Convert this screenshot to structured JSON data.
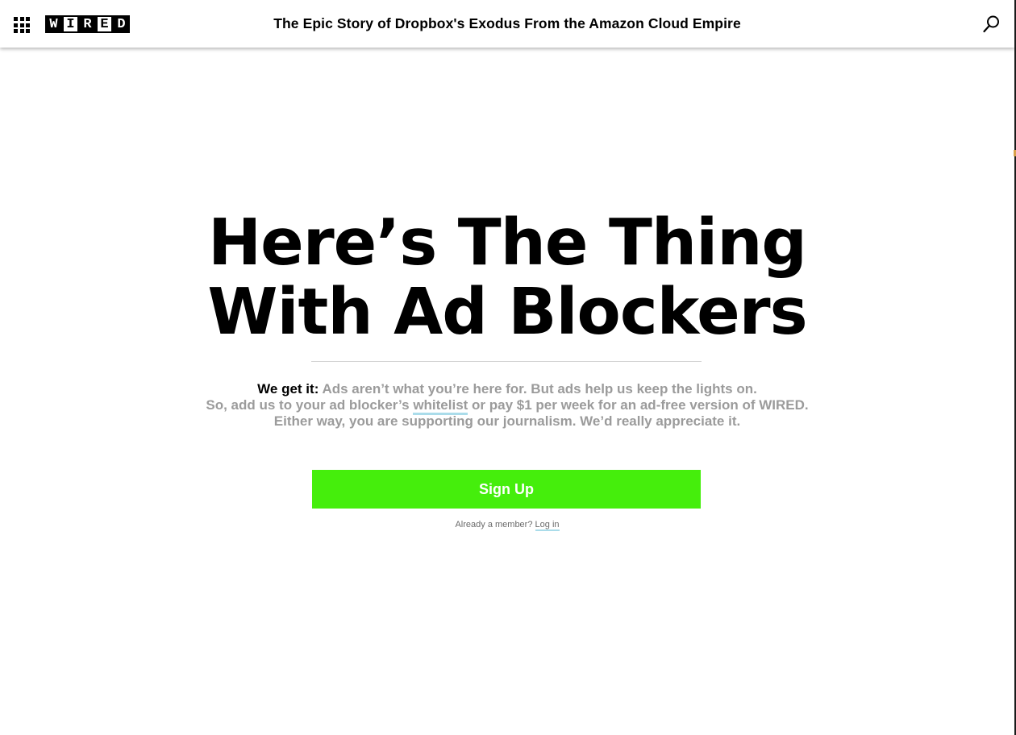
{
  "header": {
    "logo_letters": [
      "W",
      "I",
      "R",
      "E",
      "D"
    ],
    "article_title": "The Epic Story of Dropbox's Exodus From the Amazon Cloud Empire",
    "menu_icon": "grid-menu-icon",
    "search_icon": "search-icon"
  },
  "modal": {
    "headline_line1": "Here’s The Thing",
    "headline_line2": "With Ad Blockers",
    "lead": "We get it:",
    "line1_rest": " Ads aren’t what you’re here for. But ads help us keep the lights on.",
    "line2_before": "So, add us to your ad blocker’s ",
    "whitelist_link": "whitelist",
    "line2_after": " or pay $1 per week for an ad-free version of WIRED.",
    "line3": "Either way, you are supporting our journalism. We’d really appreciate it.",
    "signup_label": "Sign Up",
    "member_prompt": "Already a member?",
    "login_label": "Log in"
  },
  "colors": {
    "accent_green": "#45ee0c",
    "link_underline": "#aadcea",
    "muted_text": "#9b9b9b"
  }
}
